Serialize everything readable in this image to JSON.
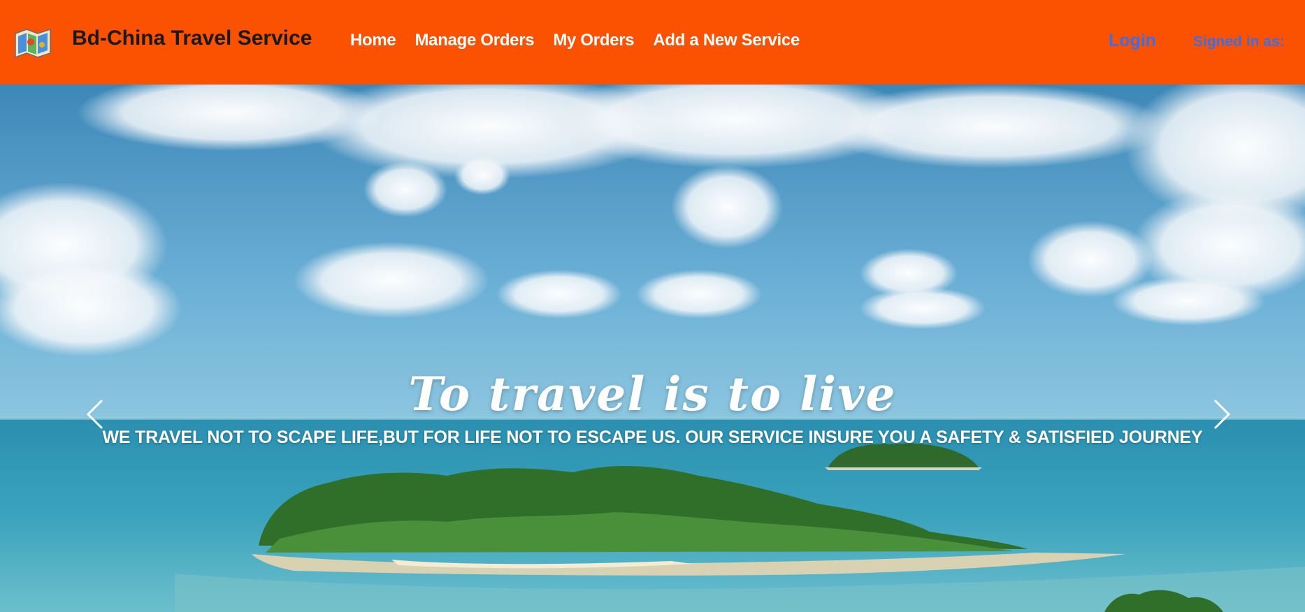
{
  "brand": {
    "name": "Bd-China Travel Service",
    "logo_icon": "map-icon"
  },
  "nav": {
    "links": [
      {
        "label": "Home"
      },
      {
        "label": "Manage Orders"
      },
      {
        "label": "My Orders"
      },
      {
        "label": "Add a New Service"
      }
    ],
    "login_label": "Login",
    "signed_in_label": "Signed in as:"
  },
  "hero": {
    "title": "To travel is to live",
    "subtitle": "WE TRAVEL NOT TO SCAPE LIFE,BUT FOR LIFE NOT TO ESCAPE US. OUR SERVICE INSURE YOU A SAFETY & SATISFIED JOURNEY",
    "prev_icon": "chevron-left-icon",
    "next_icon": "chevron-right-icon"
  },
  "colors": {
    "navbar_bg": "#fa5200",
    "brand_text": "#1a1a1a",
    "nav_text": "#ffffff",
    "login_text": "#3f6ee0"
  }
}
